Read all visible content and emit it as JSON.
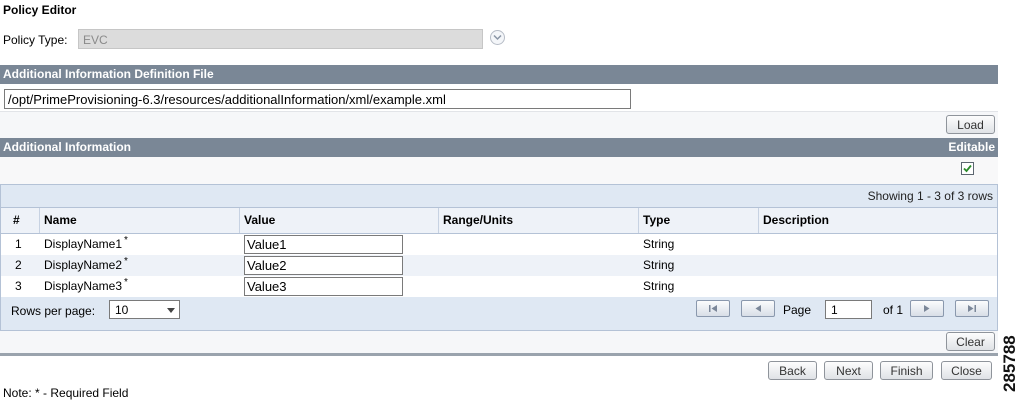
{
  "page_title": "Policy Editor",
  "policy_type": {
    "label": "Policy Type:",
    "value": "EVC"
  },
  "additional_info_file": {
    "header": "Additional Information Definition File",
    "path": "/opt/PrimeProvisioning-6.3/resources/additionalInformation/xml/example.xml",
    "load_label": "Load"
  },
  "additional_info": {
    "header": "Additional Information",
    "editable_label": "Editable",
    "editable_checked": true
  },
  "table": {
    "showing": "Showing 1 - 3 of 3 rows",
    "columns": [
      "#",
      "Name",
      "Value",
      "Range/Units",
      "Type",
      "Description"
    ],
    "rows": [
      {
        "num": "1",
        "name": "DisplayName1",
        "required": "*",
        "value": "Value1",
        "range": "",
        "type": "String",
        "description": ""
      },
      {
        "num": "2",
        "name": "DisplayName2",
        "required": "*",
        "value": "Value2",
        "range": "",
        "type": "String",
        "description": ""
      },
      {
        "num": "3",
        "name": "DisplayName3",
        "required": "*",
        "value": "Value3",
        "range": "",
        "type": "String",
        "description": ""
      }
    ],
    "rows_per_page_label": "Rows per page:",
    "rows_per_page_value": "10",
    "page_label": "Page",
    "page_value": "1",
    "of_label": "of 1"
  },
  "buttons": {
    "clear": "Clear",
    "back": "Back",
    "next": "Next",
    "finish": "Finish",
    "close": "Close"
  },
  "note": "Note: * - Required Field",
  "figure_number": "285788",
  "colors": {
    "section_bar": "#7a8796",
    "table_bg": "#dfe8f3",
    "check": "#2a8a2a"
  }
}
